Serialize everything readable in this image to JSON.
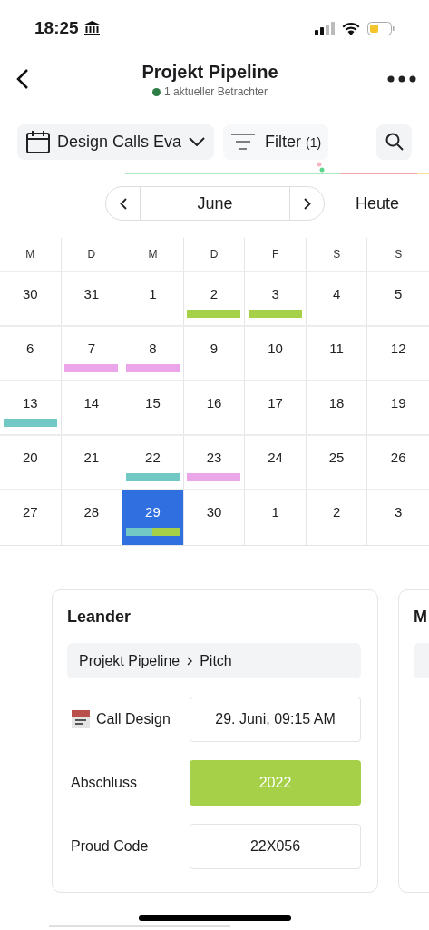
{
  "status_bar": {
    "time": "18:25"
  },
  "header": {
    "title": "Projekt Pipeline",
    "viewers": "1 aktueller Betrachter"
  },
  "toolbar": {
    "calendar_select": "Design Calls Eva",
    "filter_label": "Filter",
    "filter_count": "(1)"
  },
  "month_nav": {
    "month": "June",
    "today": "Heute"
  },
  "weekdays": [
    "M",
    "D",
    "M",
    "D",
    "F",
    "S",
    "S"
  ],
  "weeks": [
    [
      {
        "day": "30",
        "selected": false
      },
      {
        "day": "31",
        "selected": false
      },
      {
        "day": "1",
        "selected": false
      },
      {
        "day": "2",
        "selected": false,
        "events": [
          {
            "color": "#a5d047"
          }
        ]
      },
      {
        "day": "3",
        "selected": false,
        "events": [
          {
            "color": "#a5d047"
          }
        ]
      },
      {
        "day": "4",
        "selected": false
      },
      {
        "day": "5",
        "selected": false
      }
    ],
    [
      {
        "day": "6",
        "selected": false
      },
      {
        "day": "7",
        "selected": false,
        "events": [
          {
            "color": "#eba6ea"
          }
        ]
      },
      {
        "day": "8",
        "selected": false,
        "events": [
          {
            "color": "#eba6ea"
          }
        ]
      },
      {
        "day": "9",
        "selected": false
      },
      {
        "day": "10",
        "selected": false
      },
      {
        "day": "11",
        "selected": false
      },
      {
        "day": "12",
        "selected": false
      }
    ],
    [
      {
        "day": "13",
        "selected": false,
        "events": [
          {
            "color": "#72c8c4"
          }
        ]
      },
      {
        "day": "14",
        "selected": false
      },
      {
        "day": "15",
        "selected": false
      },
      {
        "day": "16",
        "selected": false
      },
      {
        "day": "17",
        "selected": false
      },
      {
        "day": "18",
        "selected": false
      },
      {
        "day": "19",
        "selected": false
      }
    ],
    [
      {
        "day": "20",
        "selected": false
      },
      {
        "day": "21",
        "selected": false
      },
      {
        "day": "22",
        "selected": false,
        "events": [
          {
            "color": "#72c8c4"
          }
        ]
      },
      {
        "day": "23",
        "selected": false,
        "events": [
          {
            "color": "#eba6ea"
          }
        ]
      },
      {
        "day": "24",
        "selected": false
      },
      {
        "day": "25",
        "selected": false
      },
      {
        "day": "26",
        "selected": false
      }
    ],
    [
      {
        "day": "27",
        "selected": false
      },
      {
        "day": "28",
        "selected": false
      },
      {
        "day": "29",
        "selected": true,
        "events": [
          {
            "color": "#72c8c4"
          },
          {
            "color": "#a5d047"
          }
        ]
      },
      {
        "day": "30",
        "selected": false
      },
      {
        "day": "1",
        "selected": false
      },
      {
        "day": "2",
        "selected": false
      },
      {
        "day": "3",
        "selected": false
      }
    ]
  ],
  "cards": [
    {
      "title": "Leander",
      "breadcrumb": [
        "Projekt Pipeline",
        "Pitch"
      ],
      "fields": [
        {
          "kind": "date",
          "label": "Call Design",
          "value": "29. Juni, 09:15 AM"
        },
        {
          "kind": "tag",
          "label": "Abschluss",
          "value": "2022"
        },
        {
          "kind": "text",
          "label": "Proud Code",
          "value": "22X056"
        }
      ]
    },
    {
      "title": "M"
    }
  ]
}
